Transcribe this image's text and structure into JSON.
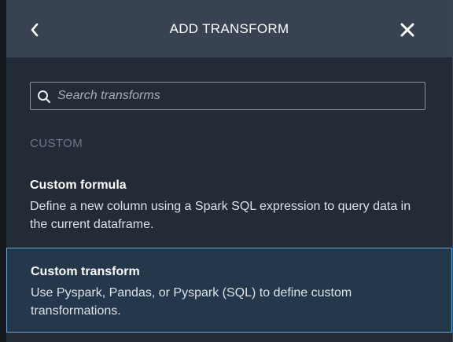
{
  "header": {
    "title": "ADD TRANSFORM",
    "back_icon": "chevron-left-icon",
    "close_icon": "close-icon"
  },
  "search": {
    "placeholder": "Search transforms",
    "value": "",
    "icon": "search-icon"
  },
  "section": {
    "label": "CUSTOM"
  },
  "items": [
    {
      "title": "Custom formula",
      "description": "Define a new column using a Spark SQL expression to query data in the current dataframe.",
      "selected": false
    },
    {
      "title": "Custom transform",
      "description": "Use Pyspark, Pandas, or Pyspark (SQL) to define custom transformations.",
      "selected": true
    }
  ],
  "colors": {
    "header_bg": "#384251",
    "panel_bg": "#232b37",
    "selected_bg": "#25384b",
    "selected_border": "#5fa8d8",
    "section_label": "#6f7885"
  }
}
